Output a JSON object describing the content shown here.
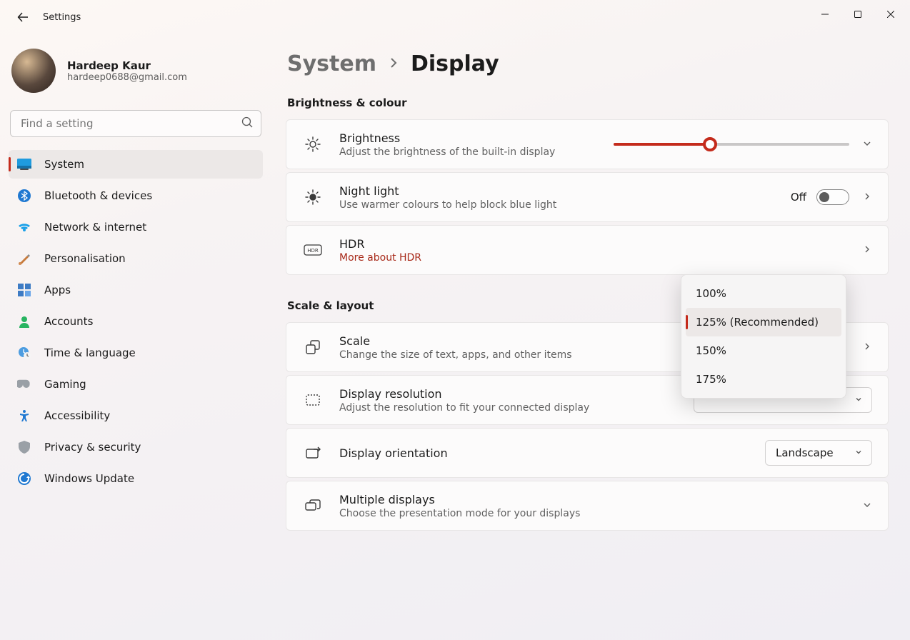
{
  "app": {
    "title": "Settings"
  },
  "user": {
    "name": "Hardeep Kaur",
    "email": "hardeep0688@gmail.com"
  },
  "search": {
    "placeholder": "Find a setting"
  },
  "nav": {
    "items": [
      {
        "label": "System"
      },
      {
        "label": "Bluetooth & devices"
      },
      {
        "label": "Network & internet"
      },
      {
        "label": "Personalisation"
      },
      {
        "label": "Apps"
      },
      {
        "label": "Accounts"
      },
      {
        "label": "Time & language"
      },
      {
        "label": "Gaming"
      },
      {
        "label": "Accessibility"
      },
      {
        "label": "Privacy & security"
      },
      {
        "label": "Windows Update"
      }
    ],
    "active_index": 0
  },
  "breadcrumb": {
    "parent": "System",
    "current": "Display"
  },
  "sections": {
    "brightness_colour": {
      "title": "Brightness & colour",
      "brightness": {
        "title": "Brightness",
        "sub": "Adjust the brightness of the built-in display",
        "value_pct": 41
      },
      "night_light": {
        "title": "Night light",
        "sub": "Use warmer colours to help block blue light",
        "state_label": "Off",
        "on": false
      },
      "hdr": {
        "title": "HDR",
        "link": "More about HDR"
      }
    },
    "scale_layout": {
      "title": "Scale & layout",
      "scale": {
        "title": "Scale",
        "sub": "Change the size of text, apps, and other items",
        "options": [
          "100%",
          "125% (Recommended)",
          "150%",
          "175%"
        ],
        "selected_index": 1
      },
      "resolution": {
        "title": "Display resolution",
        "sub": "Adjust the resolution to fit your connected display"
      },
      "orientation": {
        "title": "Display orientation",
        "value": "Landscape"
      },
      "multiple": {
        "title": "Multiple displays",
        "sub": "Choose the presentation mode for your displays"
      }
    }
  }
}
